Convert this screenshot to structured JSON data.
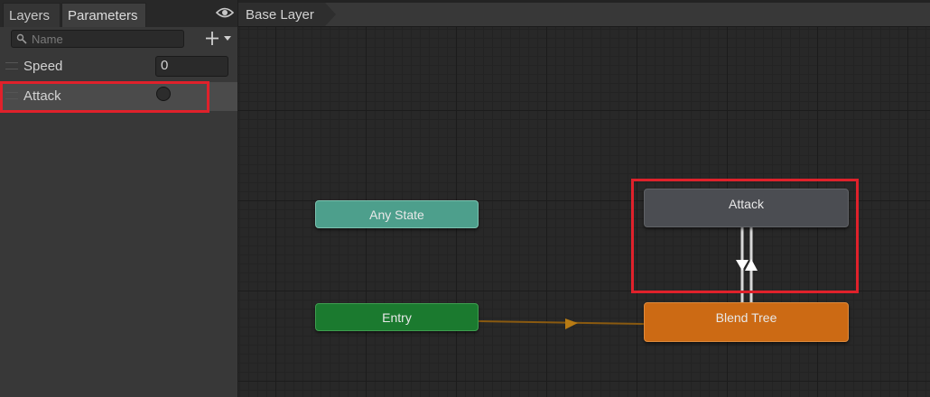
{
  "tabs": {
    "layers": "Layers",
    "parameters": "Parameters"
  },
  "search": {
    "placeholder": "Name",
    "value": ""
  },
  "parameters": [
    {
      "name": "Speed",
      "type": "float",
      "value": "0"
    },
    {
      "name": "Attack",
      "type": "trigger",
      "value": ""
    }
  ],
  "breadcrumb": {
    "layer": "Base Layer"
  },
  "states": {
    "any_state": "Any State",
    "entry": "Entry",
    "attack": "Attack",
    "blend_tree": "Blend Tree"
  },
  "colors": {
    "highlight": "#e0212b",
    "any_state": "#4d9f8c",
    "entry": "#1b7a2f",
    "attack": "#4b4d52",
    "blend_tree": "#cc6a14",
    "entry_transition": "#8a5a10"
  },
  "icons": {
    "eye": "eye-icon",
    "search": "search-icon",
    "add": "plus-icon",
    "dropdown": "chevron-down-icon"
  }
}
